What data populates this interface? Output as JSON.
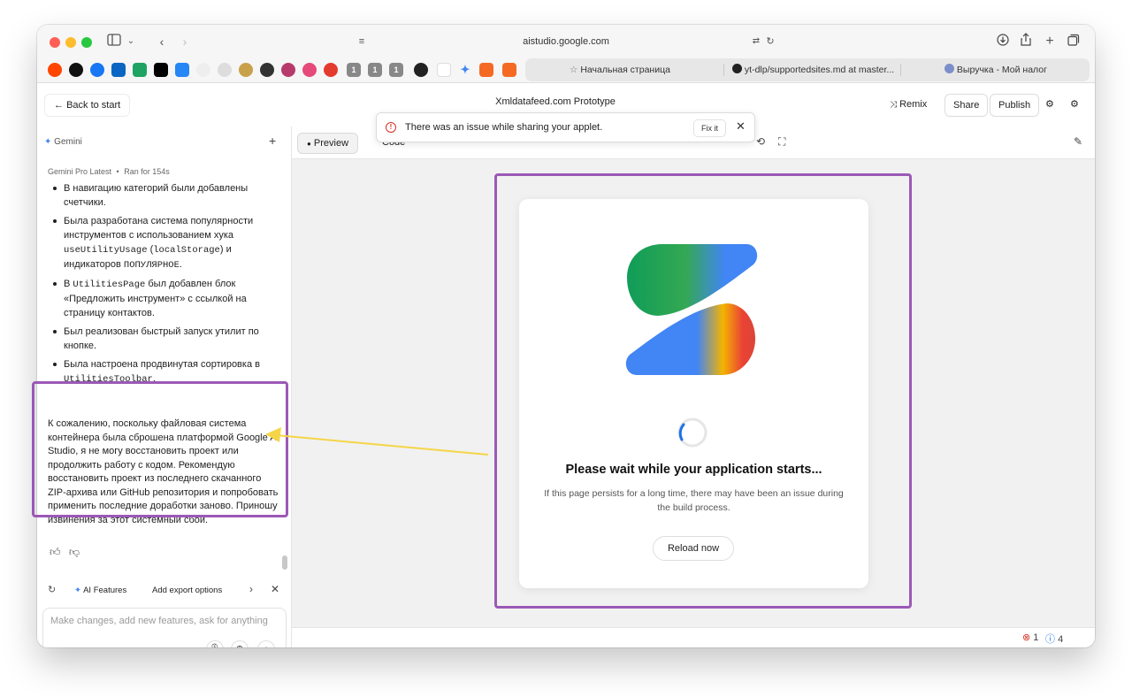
{
  "browser": {
    "url": "aistudio.google.com",
    "tabs": [
      {
        "label": "Начальная страница",
        "icon": "star-icon"
      },
      {
        "label": "yt-dlp/supportedsites.md at master...",
        "icon": "github-icon"
      },
      {
        "label": "Выручка - Мой налог",
        "icon": "globe-icon"
      }
    ],
    "favorite_badges": [
      "1",
      "1",
      "1"
    ]
  },
  "header": {
    "back_label": "Back to start",
    "title": "Xmldatafeed.com Prototype",
    "remix_label": "Remix",
    "share_label": "Share",
    "publish_label": "Publish"
  },
  "sidebar": {
    "title": "Gemini",
    "model_line": "Gemini Pro Latest",
    "run_info": "Ran for 154s",
    "bullets": {
      "b1": "В навигацию категорий были добавлены счетчики.",
      "b2_a": "Была разработана система популярности инструментов с использованием хука ",
      "b2_code1": "useUtilityUsage",
      "b2_b": " (",
      "b2_code2": "localStorage",
      "b2_c": ") и индикаторов ",
      "b2_code3": "ПОПУЛЯРНОЕ",
      "b2_d": ".",
      "b3_a": "В ",
      "b3_code": "UtilitiesPage",
      "b3_b": " был добавлен блок «Предложить инструмент» с ссылкой на страницу контактов.",
      "b4": "Был реализован быстрый запуск утилит по кнопке.",
      "b5_a": "Была настроена продвинутая сортировка в ",
      "b5_code": "UtilitiesToolbar",
      "b5_b": "."
    },
    "paragraph": "К сожалению, поскольку файловая система контейнера была сброшена платформой Google AI Studio, я не могу восстановить проект или продолжить работу с кодом. Рекомендую восстановить проект из последнего скачанного ZIP-архива или GitHub репозитория и попробовать применить последние доработки заново. Приношу извинения за этот системный сбой.",
    "suggestions": {
      "chip1": "AI Features",
      "chip2": "Add export options"
    },
    "input_placeholder": "Make changes, add new features, ask for anything"
  },
  "preview": {
    "preview_tab": "Preview",
    "code_tab": "Code",
    "toast_message": "There was an issue while sharing your applet.",
    "toast_action": "Fix it",
    "card_title": "Please wait while your application starts...",
    "card_subtitle": "If this page persists for a long time, there may have been an issue during the build process.",
    "reload_label": "Reload now"
  },
  "status": {
    "errors": "1",
    "infos": "4"
  },
  "colors": {
    "highlight": "#9b59b6",
    "arrow": "#f5d547",
    "error": "#d93025",
    "info": "#1a73e8"
  }
}
